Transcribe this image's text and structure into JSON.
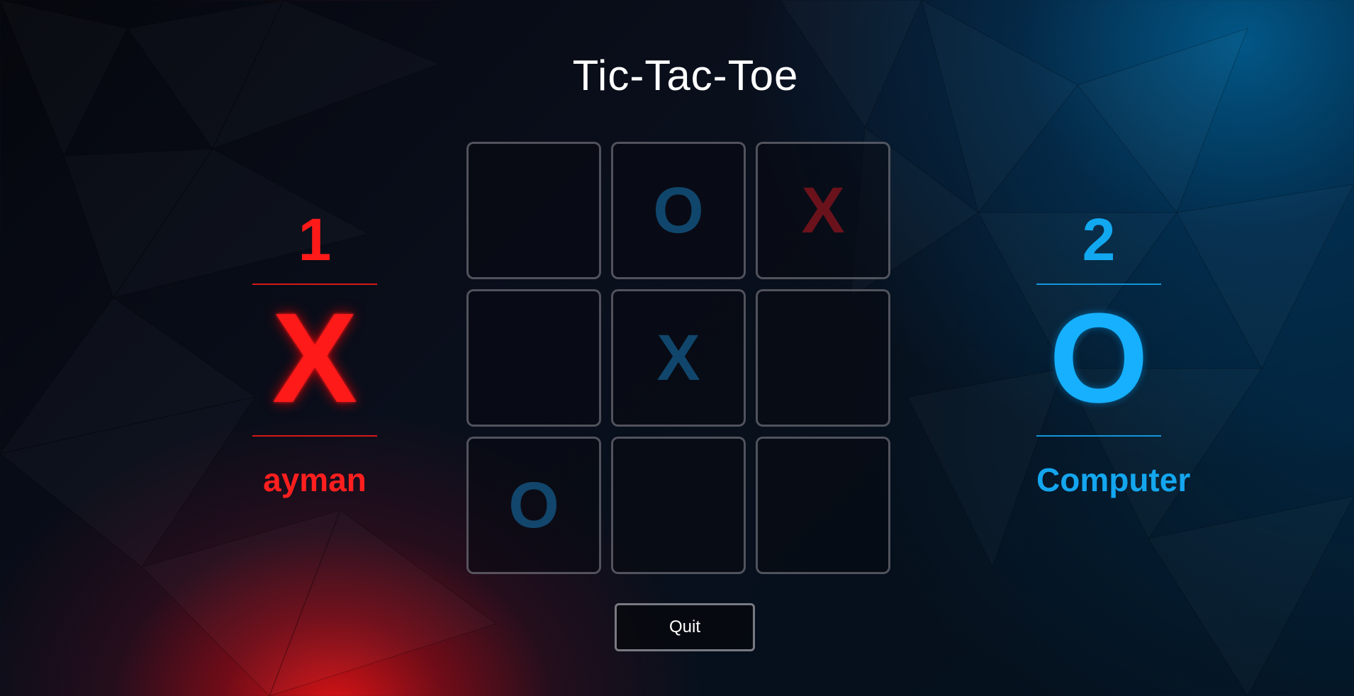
{
  "app": {
    "title": "Tic-Tac-Toe"
  },
  "board": {
    "cells": [
      "",
      "O",
      "X",
      "",
      "X",
      "",
      "O",
      "",
      ""
    ]
  },
  "players": [
    {
      "score": "1",
      "symbol": "X",
      "name": "ayman",
      "color": "#ff1a1a"
    },
    {
      "score": "2",
      "symbol": "O",
      "name": "Computer",
      "color": "#12a8f0"
    }
  ],
  "actions": {
    "quit_label": "Quit"
  }
}
